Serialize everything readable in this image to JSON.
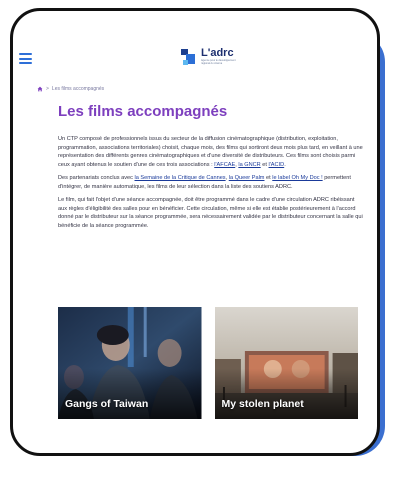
{
  "colors": {
    "accent": "#7d3fbe",
    "brand": "#2e6fd8",
    "shadow": "#3b6fd0",
    "link": "#1a3a9a"
  },
  "header": {
    "menu_icon": "hamburger-menu-icon",
    "logo_name": "L'adrc",
    "logo_tagline": "Agence pour le développement régional du cinéma"
  },
  "breadcrumb": {
    "home_icon": "home-icon",
    "separator": ">",
    "current": "Les films accompagnés"
  },
  "page": {
    "title": "Les films accompagnés"
  },
  "body": {
    "p1": "Un CTP composé de professionnels issus du secteur de la diffusion cinématographique (distribution, exploitation, programmation, associations territoriales) choisit, chaque mois, des films qui sortiront deux mois plus tard, en veillant à une représentation des différents genres cinématographiques et d'une diversité de distributeurs. Ces films sont choisis parmi ceux ayant obtenus le soutien d'une de ces trois associations :",
    "p1_link1": "l'AFCAE",
    "p1_sep1": ", ",
    "p1_link2": "la GNCR",
    "p1_sep2": " et ",
    "p1_link3": "l'ACID",
    "p1_end": ".",
    "p2_start": "Des partenariats conclus avec ",
    "p2_link1": "la Semaine de la Critique de Cannes",
    "p2_sep1": ", ",
    "p2_link2": "la Queer Palm",
    "p2_sep2": " et ",
    "p2_link3": "le label Oh My Doc !",
    "p2_end": " permettent d'intégrer, de manière automatique, les films de leur sélection dans la liste des soutiens ADRC.",
    "p3": "Le film, qui fait l'objet d'une séance accompagnée, doit être programmé dans le cadre d'une circulation ADRC ribéissant aux règles d'éligibilité des salles pour en bénéficier. Cette circulation, même si elle est établie postérieurement à l'accord donné par le distributeur sur la séance programmée, sera nécessairement validée par le distributeur concernant la salle qui bénéficie de la séance programmée."
  },
  "cards": [
    {
      "title": "Gangs of Taiwan"
    },
    {
      "title": "My stolen planet"
    }
  ]
}
